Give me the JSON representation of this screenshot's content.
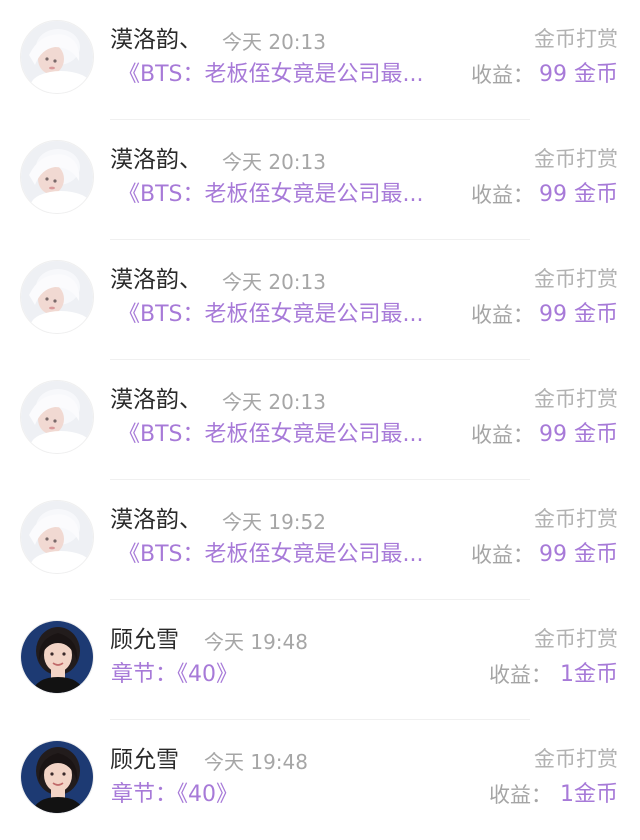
{
  "records": [
    {
      "avatar": "white-hair-portrait",
      "name": "漠洛韵、",
      "time": "今天 20:13",
      "type": "金币打赏",
      "title": "《BTS：老板侄女竟是公司最...",
      "earn_label": "收益：",
      "earn_value": "99 金币"
    },
    {
      "avatar": "white-hair-portrait",
      "name": "漠洛韵、",
      "time": "今天 20:13",
      "type": "金币打赏",
      "title": "《BTS：老板侄女竟是公司最...",
      "earn_label": "收益：",
      "earn_value": "99 金币"
    },
    {
      "avatar": "white-hair-portrait",
      "name": "漠洛韵、",
      "time": "今天 20:13",
      "type": "金币打赏",
      "title": "《BTS：老板侄女竟是公司最...",
      "earn_label": "收益：",
      "earn_value": "99 金币"
    },
    {
      "avatar": "white-hair-portrait",
      "name": "漠洛韵、",
      "time": "今天 20:13",
      "type": "金币打赏",
      "title": "《BTS：老板侄女竟是公司最...",
      "earn_label": "收益：",
      "earn_value": "99 金币"
    },
    {
      "avatar": "white-hair-portrait",
      "name": "漠洛韵、",
      "time": "今天 19:52",
      "type": "金币打赏",
      "title": "《BTS：老板侄女竟是公司最...",
      "earn_label": "收益：",
      "earn_value": "99 金币"
    },
    {
      "avatar": "dark-hair-portrait",
      "name": "顾允雪",
      "time": "今天 19:48",
      "type": "金币打赏",
      "title": "章节：《40》",
      "earn_label": "收益：",
      "earn_value": "1金币"
    },
    {
      "avatar": "dark-hair-portrait",
      "name": "顾允雪",
      "time": "今天 19:48",
      "type": "金币打赏",
      "title": "章节：《40》",
      "earn_label": "收益：",
      "earn_value": "1金币"
    }
  ],
  "colors": {
    "accent_purple": "#a77ad8",
    "name_text": "#2a2a2a",
    "muted_text": "#a6a6a6",
    "divider": "#f0f0f0"
  }
}
